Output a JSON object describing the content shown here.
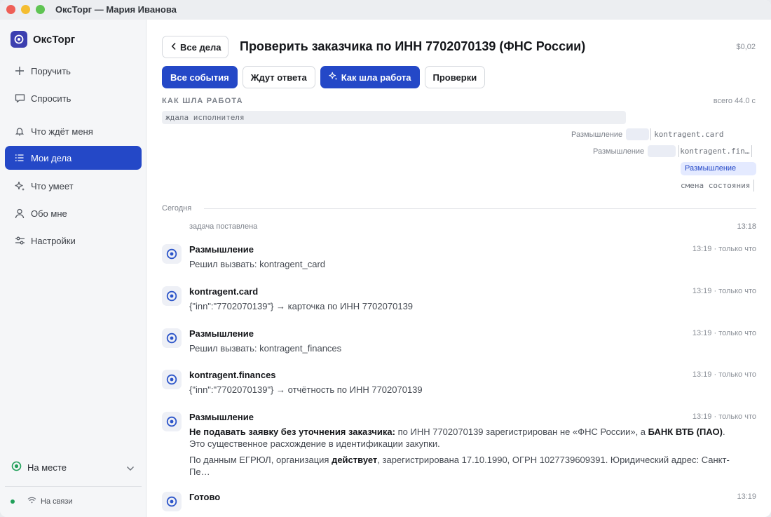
{
  "window": {
    "title": "ОксТорг — Мария Иванова"
  },
  "brand": {
    "name": "ОксТорг"
  },
  "sidebar": {
    "items": [
      {
        "label": "Поручить",
        "icon": "plus-icon"
      },
      {
        "label": "Спросить",
        "icon": "chat-icon"
      },
      {
        "label": "Что ждёт меня",
        "icon": "bell-icon"
      },
      {
        "label": "Мои дела",
        "icon": "list-icon",
        "active": true
      },
      {
        "label": "Что умеет",
        "icon": "sparkle-icon"
      },
      {
        "label": "Обо мне",
        "icon": "person-icon"
      },
      {
        "label": "Настройки",
        "icon": "sliders-icon"
      }
    ],
    "status": "На месте",
    "connection": "На связи"
  },
  "header": {
    "back_label": "Все дела",
    "title": "Проверить заказчика по ИНН 7702070139 (ФНС России)",
    "cost": "$0,02"
  },
  "tabs": [
    {
      "label": "Все события",
      "primary": true
    },
    {
      "label": "Ждут ответа",
      "primary": false
    },
    {
      "label": "Как шла работа",
      "primary": true,
      "icon": "sparkle-icon"
    },
    {
      "label": "Проверки",
      "primary": false
    }
  ],
  "timeline": {
    "section_label": "КАК ШЛА РАБОТА",
    "total": "всего 44.0 с",
    "bar_label": "ждала исполнителя",
    "rows": [
      {
        "label": "Размышление",
        "tool": "kontragent.card"
      },
      {
        "label": "Размышление",
        "tool": "kontragent.fin…"
      },
      {
        "think": "Размышление"
      },
      {
        "state": "смена состояния"
      }
    ]
  },
  "feed": {
    "day_label": "Сегодня",
    "task_set": {
      "text": "задача поставлена",
      "time": "13:18"
    },
    "events": [
      {
        "title": "Размышление",
        "time": "13:19 · только что",
        "body": "Решил вызвать: kontragent_card"
      },
      {
        "title": "kontragent.card",
        "time": "13:19 · только что",
        "body": "{\"inn\":\"7702070139\"} → карточка по ИНН 7702070139"
      },
      {
        "title": "Размышление",
        "time": "13:19 · только что",
        "body": "Решил вызвать: kontragent_finances"
      },
      {
        "title": "kontragent.finances",
        "time": "13:19 · только что",
        "body": "{\"inn\":\"7702070139\"} → отчётность по ИНН 7702070139"
      },
      {
        "title": "Размышление",
        "time": "13:19 · только что",
        "p1_bold": "Не подавать заявку без уточнения заказчика:",
        "p1_text": " по ИНН 7702070139 зарегистрирован не «ФНС России», а ",
        "p1_bold2": "БАНК ВТБ (ПАО)",
        "p1_end": ". Это существенное расхождение в идентификации закупки.",
        "p2_text": "По данным ЕГРЮЛ, организация ",
        "p2_bold": "действует",
        "p2_end": ", зарегистрирована 17.10.1990, ОГРН 1027739609391. Юридический адрес: Санкт-Пе…"
      },
      {
        "title": "Готово",
        "time": "13:19"
      }
    ]
  }
}
